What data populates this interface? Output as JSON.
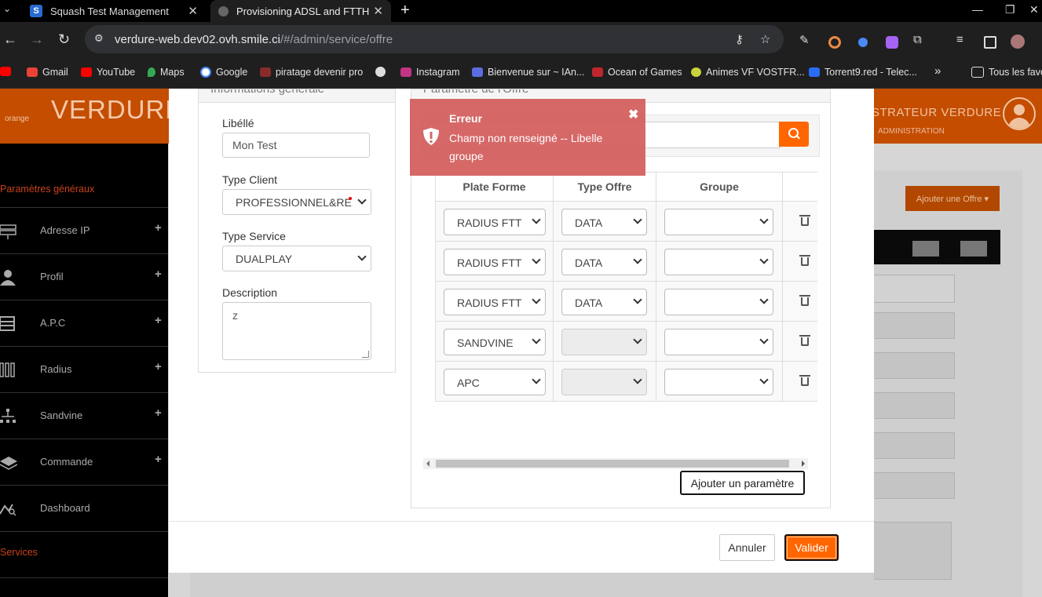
{
  "browser": {
    "tabs": [
      {
        "title": "Squash Test Management",
        "active": false
      },
      {
        "title": "Provisioning ADSL and FTTH",
        "active": true
      }
    ],
    "url_host": "verdure-web.dev02.ovh.smile.ci",
    "url_path": "/#/admin/service/offre",
    "bookmarks": [
      {
        "label": "Gmail",
        "color": "#ea4335"
      },
      {
        "label": "YouTube",
        "color": "#ff0000"
      },
      {
        "label": "Maps",
        "color": "#34a853"
      },
      {
        "label": "Google",
        "color": "#4285f4"
      },
      {
        "label": "piratage devenir pro",
        "color": "#8a2b2b"
      },
      {
        "label": "",
        "color": "#dddddd"
      },
      {
        "label": "Instagram",
        "color": "#c13584"
      },
      {
        "label": "Bienvenue sur ~ IAn...",
        "color": "#5b6ee1"
      },
      {
        "label": "Ocean of Games",
        "color": "#c0262d"
      },
      {
        "label": "Animes VF VOSTFR...",
        "color": "#c9d33b"
      },
      {
        "label": "Torrent9.red - Telec...",
        "color": "#2a6df4"
      }
    ],
    "bookmarks_more": "»",
    "bookmarks_folder": "Tous les favo"
  },
  "app": {
    "brand_small": "orange",
    "brand": "VERDURE",
    "user": "STRATEUR VERDURE",
    "user_sub": "ADMINISTRATION",
    "accent": "#ff6600"
  },
  "sidebar": {
    "section1": "Paramètres généraux",
    "items": [
      {
        "label": "Adresse IP",
        "icon": "server-icon"
      },
      {
        "label": "Profil",
        "icon": "user-icon"
      },
      {
        "label": "A.P.C",
        "icon": "table-icon"
      },
      {
        "label": "Radius",
        "icon": "columns-icon"
      },
      {
        "label": "Sandvine",
        "icon": "sitemap-icon"
      },
      {
        "label": "Commande",
        "icon": "layers-icon"
      },
      {
        "label": "Dashboard",
        "icon": "chart-icon"
      }
    ],
    "section2": "Services"
  },
  "background": {
    "add_offer": "Ajouter une Offre ▾"
  },
  "modal": {
    "left_panel_title": "Informations générale",
    "right_panel_title": "Paramètre de l'Offre",
    "libelle_label": "Libéllé",
    "libelle_value": "Mon Test",
    "type_client_label": "Type Client",
    "type_client_value": "PROFESSIONNEL&RE",
    "type_service_label": "Type Service",
    "type_service_value": "DUALPLAY",
    "description_label": "Description",
    "description_value": "z",
    "table": {
      "headers": [
        "Plate Forme",
        "Type Offre",
        "Groupe"
      ],
      "rows": [
        {
          "plateforme": "RADIUS FTT",
          "type_offre": "DATA",
          "groupe": ""
        },
        {
          "plateforme": "RADIUS FTT",
          "type_offre": "DATA",
          "groupe": ""
        },
        {
          "plateforme": "RADIUS FTT",
          "type_offre": "DATA",
          "groupe": ""
        },
        {
          "plateforme": "SANDVINE",
          "type_offre": "",
          "groupe": ""
        },
        {
          "plateforme": "APC",
          "type_offre": "",
          "groupe": ""
        }
      ]
    },
    "add_param": "Ajouter un paramètre",
    "cancel": "Annuler",
    "submit": "Valider"
  },
  "toast": {
    "title": "Erreur",
    "message": "Champ non renseigné -- Libelle groupe",
    "close": "✖",
    "color": "#d46060"
  }
}
